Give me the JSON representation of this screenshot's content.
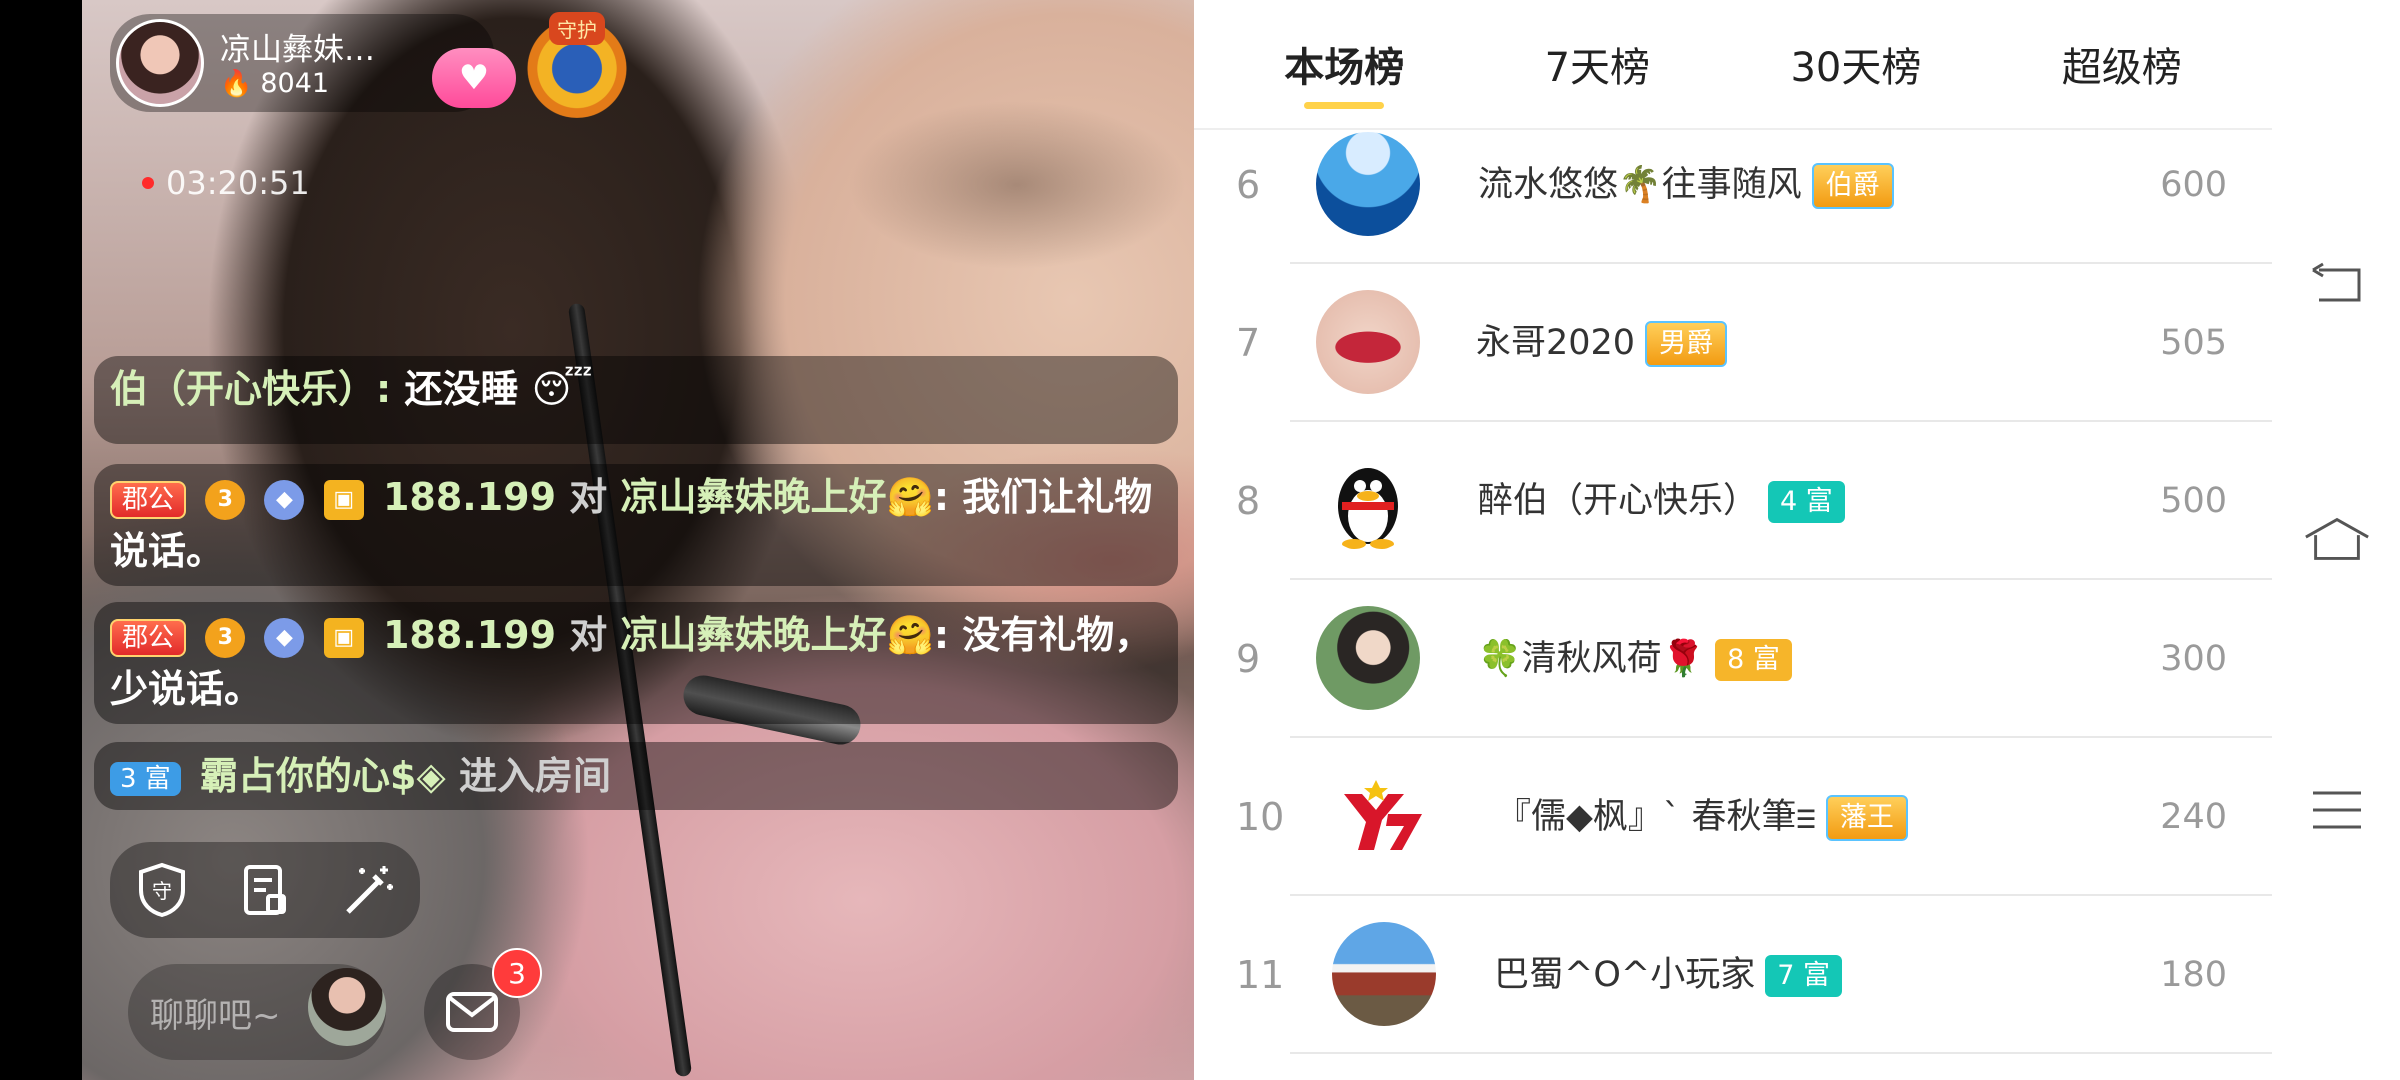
{
  "stream": {
    "anchor_name": "凉山彝妹…",
    "hot_count": "8041",
    "guard_label": "守护",
    "live_time": "03:20:51",
    "chat_placeholder": "聊聊吧~",
    "mail_badge": "3"
  },
  "chat_messages": [
    {
      "name": "伯（开心快乐）:",
      "text": "还没睡",
      "emoji": "😴"
    },
    {
      "badge": "郡公",
      "level": "3",
      "name": "188.199",
      "to_word": "对",
      "target": "凉山彝妹晚上好🤗",
      "text": ": 我们让礼物说话。"
    },
    {
      "badge": "郡公",
      "level": "3",
      "name": "188.199",
      "to_word": "对",
      "target": "凉山彝妹晚上好🤗",
      "text": ": 没有礼物，少说话。"
    },
    {
      "badge": "3 富",
      "name": "霸占你的心$◈",
      "text": "进入房间"
    }
  ],
  "tabs": [
    "本场榜",
    "7天榜",
    "30天榜",
    "超级榜"
  ],
  "ranking": [
    {
      "rank": "6",
      "name": "流水悠悠🌴往事随风",
      "badge": "伯爵",
      "badge_style": "gold",
      "score": "600"
    },
    {
      "rank": "7",
      "name": "永哥2020",
      "badge": "男爵",
      "badge_style": "gold",
      "score": "505"
    },
    {
      "rank": "8",
      "name": "醉伯（开心快乐）",
      "badge": "4 富",
      "badge_style": "teal",
      "score": "500"
    },
    {
      "rank": "9",
      "name": "🍀清秋风荷🌹",
      "badge": "8 富",
      "badge_style": "orange",
      "score": "300"
    },
    {
      "rank": "10",
      "name": "『儒◆枫』ˋ 春秋筆ⲷ",
      "badge": "藩王",
      "badge_style": "gold",
      "score": "240"
    },
    {
      "rank": "11",
      "name": "巴蜀^O^小玩家",
      "badge": "7 富",
      "badge_style": "teal",
      "score": "180"
    }
  ],
  "icons": {
    "fire": "fire-icon",
    "follow": "heart-icon",
    "guard": "shield-icon",
    "task": "clipboard-icon",
    "magic": "magic-wand-icon",
    "mail": "mail-icon",
    "back": "back-icon",
    "home": "home-icon",
    "menu": "menu-icon"
  },
  "colors": {
    "tab_indicator": "#ffd24a",
    "rich_badge": "#14c7b6",
    "noble_badge": "#f29b12",
    "chat_name": "#d6f0b8",
    "notification": "#ff3b3b"
  }
}
